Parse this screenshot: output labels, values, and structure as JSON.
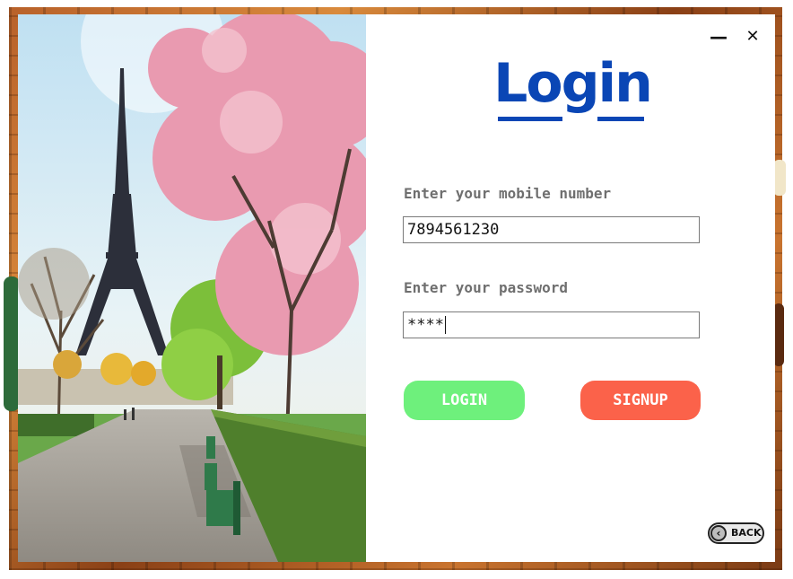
{
  "window": {
    "minimize_label": "—",
    "close_label": "✕"
  },
  "login": {
    "title": "Login",
    "mobile_label": "Enter your mobile number",
    "mobile_value": "7894561230",
    "password_label": "Enter your password",
    "password_value": "****",
    "login_button": "LOGIN",
    "signup_button": "SIGNUP",
    "back_button": "BACK"
  },
  "colors": {
    "title": "#0a46b5",
    "login_button": "#6ef07c",
    "signup_button": "#fb624a",
    "label": "#6f6f6f"
  },
  "icons": {
    "minimize": "minimize-icon",
    "close": "close-icon",
    "back": "chevron-left-icon"
  }
}
